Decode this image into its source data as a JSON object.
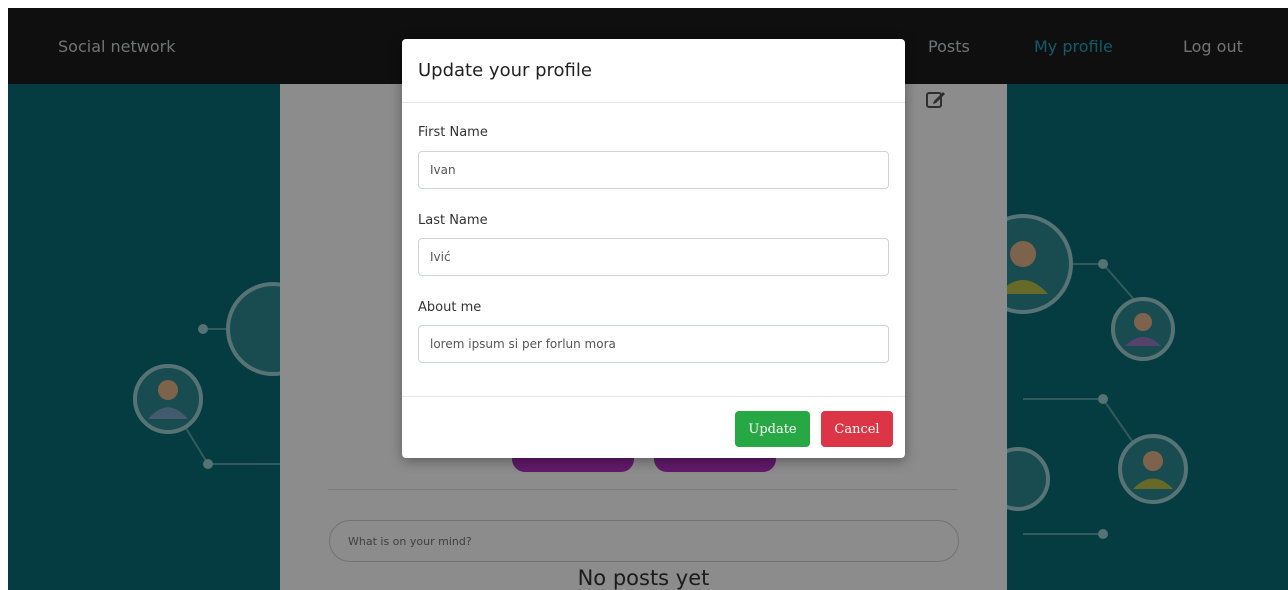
{
  "navbar": {
    "brand": "Social network",
    "links": {
      "posts": "Posts",
      "my_profile": "My profile",
      "log_out": "Log out"
    },
    "active_link": "My profile",
    "active_color": "#1ba8c0"
  },
  "background": {
    "color": "#0a6e78"
  },
  "profile_page": {
    "post_input_placeholder": "What is on your mind?",
    "empty_posts_text": "No posts yet",
    "pill_color": "#b130c2",
    "edit_icon": "edit-pencil-icon"
  },
  "modal": {
    "title": "Update your profile",
    "fields": {
      "first_name": {
        "label": "First Name",
        "value": "Ivan"
      },
      "last_name": {
        "label": "Last Name",
        "value": "Ivić"
      },
      "about_me": {
        "label": "About me",
        "value": "lorem ipsum si per forlun mora"
      }
    },
    "buttons": {
      "update": "Update",
      "cancel": "Cancel"
    },
    "colors": {
      "update": "#28a745",
      "cancel": "#dc3545"
    }
  }
}
